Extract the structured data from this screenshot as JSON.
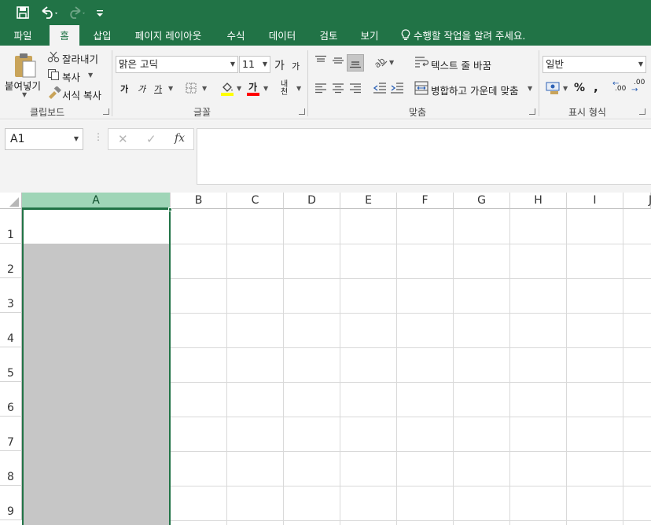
{
  "colors": {
    "brand": "#217346",
    "selection_fill": "#c6c6c6",
    "selected_header": "#9fd5b7"
  },
  "qat": {
    "save_icon": "save-icon",
    "undo_icon": "undo-icon",
    "redo_icon": "redo-icon",
    "customize_icon": "customize-qat-icon"
  },
  "tabs": [
    {
      "label": "파일"
    },
    {
      "label": "홈"
    },
    {
      "label": "삽입"
    },
    {
      "label": "페이지 레이아웃"
    },
    {
      "label": "수식"
    },
    {
      "label": "데이터"
    },
    {
      "label": "검토"
    },
    {
      "label": "보기"
    }
  ],
  "tell_me": "수행할 작업을 알려 주세요.",
  "clipboard": {
    "paste": "붙여넣기",
    "cut": "잘라내기",
    "copy": "복사",
    "format_painter": "서식 복사",
    "group": "클립보드"
  },
  "font": {
    "name": "맑은 고딕",
    "size": "11",
    "grow": "가",
    "shrink": "가",
    "bold": "가",
    "italic": "가",
    "underline": "가",
    "color_glyph": "가",
    "phonetic": "내천",
    "group": "글꼴"
  },
  "alignment": {
    "wrap_text": "텍스트 줄 바꿈",
    "merge_center": "병합하고 가운데 맞춤",
    "group": "맞춤"
  },
  "number": {
    "format": "일반",
    "percent": "%",
    "comma": ",",
    "inc_decimal": ".00",
    "dec_decimal": ".00",
    "group": "표시 형식"
  },
  "formula_bar": {
    "name_box": "A1",
    "cancel": "✕",
    "enter": "✓",
    "fx": "fx",
    "value": ""
  },
  "sheet": {
    "columns": [
      "A",
      "B",
      "C",
      "D",
      "E",
      "F",
      "G",
      "H",
      "I",
      "J"
    ],
    "rows": [
      "1",
      "2",
      "3",
      "4",
      "5",
      "6",
      "7",
      "8",
      "9"
    ],
    "active_cell": "A1",
    "selected_range": "A1:A9"
  }
}
